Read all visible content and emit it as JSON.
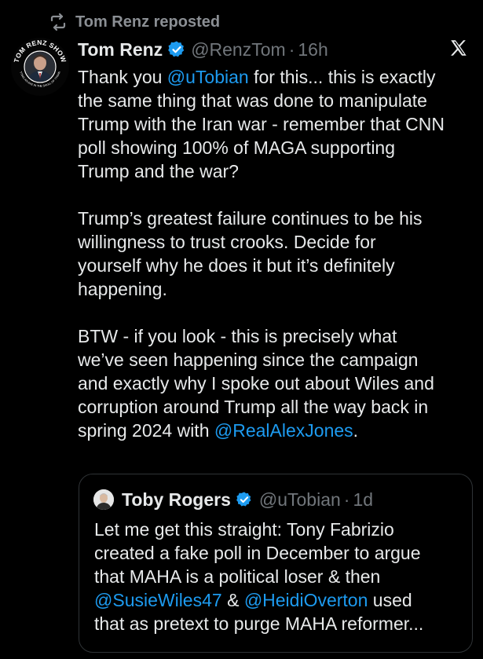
{
  "repost": {
    "label": "Tom Renz reposted"
  },
  "avatar": {
    "ring_text": "TOM RENZ SHOW",
    "lower_text": "PUTTING AN AXE IN THE SKULL OF TYRANNY"
  },
  "post": {
    "display_name": "Tom Renz",
    "handle": "@RenzTom",
    "separator": "·",
    "time": "16h",
    "text_p1_a": "Thank you ",
    "text_p1_mention": "@uTobian",
    "text_p1_b": " for this... this is exactly\nthe same thing that was done to manipulate\nTrump with the Iran war - remember that CNN\npoll showing 100% of MAGA supporting\nTrump and the war?\n\nTrump’s greatest failure continues to be his\nwillingness to trust crooks. Decide for\nyourself why he does it but it’s definitely\nhappening.\n\nBTW - if you look - this is precisely what\nwe’ve seen happening since the campaign\nand exactly why I spoke out about Wiles and\ncorruption around Trump all the way back in\nspring 2024 with ",
    "text_p1_mention2": "@RealAlexJones",
    "text_p1_end": "."
  },
  "quote": {
    "display_name": "Toby Rogers",
    "handle": "@uTobian",
    "separator": "·",
    "time": "1d",
    "text_a": "Let me get this straight: Tony Fabrizio\ncreated a fake poll in December to argue\nthat MAHA is a political loser & then\n",
    "mention1": "@SusieWiles47",
    "text_b": " & ",
    "mention2": "@HeidiOverton",
    "text_c": " used\nthat as pretext to purge MAHA reformer..."
  },
  "colors": {
    "background": "#000000",
    "text": "#e7e9ea",
    "muted": "#71767b",
    "link": "#1d9bf0",
    "verified": "#1d9bf0",
    "border": "#2f3336"
  },
  "icons": {
    "repost": "repost-icon",
    "verified": "verified-badge-icon",
    "logo": "x-logo-icon"
  }
}
